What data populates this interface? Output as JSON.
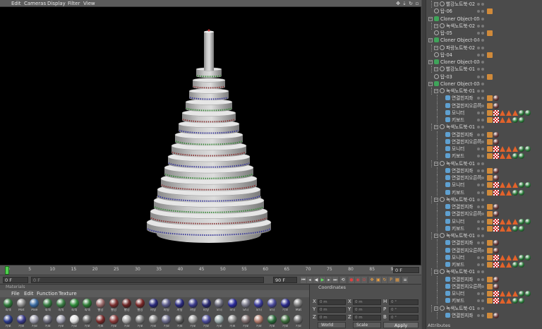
{
  "viewport": {
    "menu": [
      "Edit",
      "Cameras",
      "Display",
      "Filter",
      "View"
    ],
    "background_color": "#000000",
    "model_color": "#c8c8c8",
    "stripe_colors": [
      "#3d8a3d",
      "#8a3838",
      "#3a3a9a"
    ],
    "icons": [
      "move-icon",
      "move-down-icon",
      "rotate-icon",
      "maximize-icon"
    ]
  },
  "timeline": {
    "ticks": [
      "0",
      "5",
      "10",
      "15",
      "20",
      "25",
      "30",
      "35",
      "40",
      "45",
      "50",
      "55",
      "60",
      "65",
      "70",
      "75",
      "80",
      "85",
      "90"
    ],
    "current_frame": "0 F",
    "field_value": "0 F"
  },
  "transport": {
    "start_frame": "0 F",
    "start_field_secondary": "0 F",
    "end_frame": "90 F"
  },
  "materials": {
    "title": "Materials",
    "menu": [
      "File",
      "Edit",
      "Function",
      "Texture"
    ],
    "row1": [
      {
        "label": "녹색",
        "color": "#2f7a3a"
      },
      {
        "label": "Mat",
        "color": "#8a8a8a"
      },
      {
        "label": "Pixe",
        "color": "#3a6aa0"
      },
      {
        "label": "녹색",
        "color": "#357a40"
      },
      {
        "label": "녹색",
        "color": "#3a7e44"
      },
      {
        "label": "녹색",
        "color": "#2f8a3a"
      },
      {
        "label": "녹색",
        "color": "#2d7a35"
      },
      {
        "label": "빨강",
        "color": "#9a6a6a"
      },
      {
        "label": "빨강",
        "color": "#7a3030"
      },
      {
        "label": "빨강",
        "color": "#6a2525"
      },
      {
        "label": "빨강",
        "color": "#7a2828"
      },
      {
        "label": "파랑",
        "color": "#2a2a7a"
      },
      {
        "label": "파랑",
        "color": "#5a5a8a"
      },
      {
        "label": "파랑",
        "color": "#2a2a80"
      },
      {
        "label": "파랑",
        "color": "#3a3a8a"
      },
      {
        "label": "파랑",
        "color": "#2a2a70"
      },
      {
        "label": "모니",
        "color": "#6a6a7a"
      },
      {
        "label": "모니",
        "color": "#2a2a9a"
      },
      {
        "label": "모니",
        "color": "#7a7a8a"
      },
      {
        "label": "모니",
        "color": "#3a3a9a"
      },
      {
        "label": "모니",
        "color": "#4a4a9a"
      },
      {
        "label": "키보",
        "color": "#2a2a8a"
      },
      {
        "label": "Mat",
        "color": "#7a7a7a"
      }
    ],
    "row2": [
      {
        "label": "키보",
        "color": "#2a3a8a"
      },
      {
        "label": "키보",
        "color": "#3a3a8a"
      },
      {
        "label": "키보",
        "color": "#9a9aaa"
      },
      {
        "label": "키보",
        "color": "#6a6a7a"
      },
      {
        "label": "키보",
        "color": "#9a9aaa"
      },
      {
        "label": "키보",
        "color": "#e0e0e0"
      },
      {
        "label": "키보",
        "color": "#6a6a6a"
      },
      {
        "label": "키보",
        "color": "#7a2a2a"
      },
      {
        "label": "키보",
        "color": "#8a3a3a"
      },
      {
        "label": "키보",
        "color": "#aaaaaa"
      },
      {
        "label": "키보",
        "color": "#7a7a7a"
      },
      {
        "label": "키보",
        "color": "#8a8a8a"
      },
      {
        "label": "키보",
        "color": "#6a6a8a"
      },
      {
        "label": "키보",
        "color": "#5a5a5a"
      },
      {
        "label": "키보",
        "color": "#9a9a9a"
      },
      {
        "label": "키보",
        "color": "#4a4a9a"
      },
      {
        "label": "키보",
        "color": "#9aaaaa"
      },
      {
        "label": "키보",
        "color": "#8a8a8a"
      },
      {
        "label": "키보",
        "color": "#7a6a6a"
      },
      {
        "label": "키보",
        "color": "#b07a6a"
      },
      {
        "label": "키보",
        "color": "#2a6a3a"
      },
      {
        "label": "키보",
        "color": "#3a6a3a"
      },
      {
        "label": "키보",
        "color": "#6a6a6a"
      }
    ]
  },
  "coordinates": {
    "title": "Coordinates",
    "col_labels": [
      "X",
      "Y",
      "Z"
    ],
    "col2_labels": [
      "X",
      "Y",
      "Z"
    ],
    "col3_labels": [
      "H",
      "P",
      "B"
    ],
    "field_values": [
      "0 m",
      "0 m",
      "0 m",
      "0 m",
      "0 m",
      "0 m",
      "0 °",
      "0 °",
      "0 °"
    ],
    "dropdowns": [
      "World",
      "Scale"
    ],
    "apply_label": "Apply"
  },
  "object_manager": {
    "attributes_label": "Attributes",
    "objects": [
      {
        "name": "빨강노트북-02",
        "type": "null",
        "level": 1,
        "tags": "none"
      },
      {
        "name": "탑-06",
        "type": "null",
        "level": 0,
        "tags": "pair"
      },
      {
        "name": "Cloner Object-05",
        "type": "cloner",
        "level": 0,
        "tags": "none"
      },
      {
        "name": "녹색노트북-02",
        "type": "null",
        "level": 1,
        "tags": "none"
      },
      {
        "name": "탑-05",
        "type": "null",
        "level": 0,
        "tags": "pair"
      },
      {
        "name": "Cloner Object-04",
        "type": "cloner",
        "level": 0,
        "tags": "none"
      },
      {
        "name": "파랑노트북-02",
        "type": "null",
        "level": 1,
        "tags": "none"
      },
      {
        "name": "탑-04",
        "type": "null",
        "level": 0,
        "tags": "pair"
      },
      {
        "name": "Cloner Object-03",
        "type": "cloner",
        "level": 0,
        "tags": "none"
      },
      {
        "name": "빨강노트북-01",
        "type": "null",
        "level": 1,
        "tags": "none"
      },
      {
        "name": "탑-03",
        "type": "null",
        "level": 0,
        "tags": "pair"
      },
      {
        "name": "Cloner Object-02",
        "type": "cloner",
        "level": 0,
        "tags": "none"
      },
      {
        "name": "녹색노트북-01",
        "type": "null",
        "level": 1,
        "tags": "none"
      },
      {
        "name": "연결힌지좌",
        "type": "poly",
        "level": 2,
        "tags": "balls"
      },
      {
        "name": "연결힌지오른쪽",
        "type": "poly",
        "level": 2,
        "tags": "balls"
      },
      {
        "name": "모니터",
        "type": "poly",
        "level": 2,
        "tags": "full"
      },
      {
        "name": "키보드",
        "type": "poly",
        "level": 2,
        "tags": "full2"
      },
      {
        "name": "녹색노트북-01",
        "type": "null",
        "level": 1,
        "tags": "none"
      },
      {
        "name": "연결힌지좌",
        "type": "poly",
        "level": 2,
        "tags": "balls"
      },
      {
        "name": "연결힌지오른쪽",
        "type": "poly",
        "level": 2,
        "tags": "balls"
      },
      {
        "name": "모니터",
        "type": "poly",
        "level": 2,
        "tags": "full"
      },
      {
        "name": "키보드",
        "type": "poly",
        "level": 2,
        "tags": "full2"
      },
      {
        "name": "녹색노트북-01",
        "type": "null",
        "level": 1,
        "tags": "none"
      },
      {
        "name": "연결힌지좌",
        "type": "poly",
        "level": 2,
        "tags": "balls"
      },
      {
        "name": "연결힌지오른쪽",
        "type": "poly",
        "level": 2,
        "tags": "balls"
      },
      {
        "name": "모니터",
        "type": "poly",
        "level": 2,
        "tags": "full"
      },
      {
        "name": "키보드",
        "type": "poly",
        "level": 2,
        "tags": "full2"
      },
      {
        "name": "녹색노트북-01",
        "type": "null",
        "level": 1,
        "tags": "none"
      },
      {
        "name": "연결힌지좌",
        "type": "poly",
        "level": 2,
        "tags": "balls"
      },
      {
        "name": "연결힌지오른쪽",
        "type": "poly",
        "level": 2,
        "tags": "balls"
      },
      {
        "name": "모니터",
        "type": "poly",
        "level": 2,
        "tags": "full"
      },
      {
        "name": "키보드",
        "type": "poly",
        "level": 2,
        "tags": "full2"
      },
      {
        "name": "녹색노트북-01",
        "type": "null",
        "level": 1,
        "tags": "none"
      },
      {
        "name": "연결힌지좌",
        "type": "poly",
        "level": 2,
        "tags": "balls"
      },
      {
        "name": "연결힌지오른쪽",
        "type": "poly",
        "level": 2,
        "tags": "balls"
      },
      {
        "name": "모니터",
        "type": "poly",
        "level": 2,
        "tags": "full"
      },
      {
        "name": "키보드",
        "type": "poly",
        "level": 2,
        "tags": "full2"
      },
      {
        "name": "녹색노트북-01",
        "type": "null",
        "level": 1,
        "tags": "none"
      },
      {
        "name": "연결힌지좌",
        "type": "poly",
        "level": 2,
        "tags": "balls"
      },
      {
        "name": "연결힌지오른쪽",
        "type": "poly",
        "level": 2,
        "tags": "balls"
      },
      {
        "name": "모니터",
        "type": "poly",
        "level": 2,
        "tags": "full"
      },
      {
        "name": "키보드",
        "type": "poly",
        "level": 2,
        "tags": "full2"
      },
      {
        "name": "녹색노트북-01",
        "type": "null",
        "level": 1,
        "tags": "none"
      },
      {
        "name": "연결힌지좌",
        "type": "poly",
        "level": 2,
        "tags": "balls"
      }
    ]
  }
}
